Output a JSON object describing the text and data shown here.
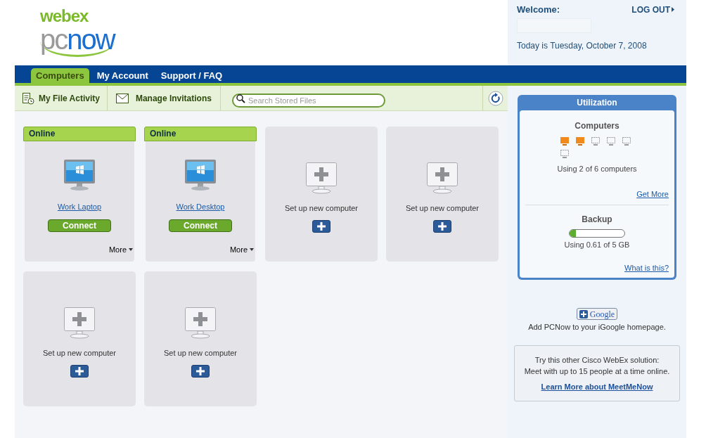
{
  "logo": {
    "brand": "webex",
    "product_prefix": "pc",
    "product_suffix": "now"
  },
  "welcome": {
    "label": "Welcome:",
    "logout": "LOG OUT",
    "date": "Today is Tuesday, October 7, 2008"
  },
  "nav_tabs": [
    {
      "label": "Computers",
      "selected": true
    },
    {
      "label": "My Account",
      "selected": false
    },
    {
      "label": "Support / FAQ",
      "selected": false
    }
  ],
  "toolbar": {
    "file_activity": "My File Activity",
    "invitations": "Manage Invitations",
    "search": {
      "placeholder": "Search Stored Files"
    }
  },
  "computers": [
    {
      "kind": "online",
      "status": "Online",
      "name": "Work Laptop",
      "action": "Connect",
      "more": "More"
    },
    {
      "kind": "online",
      "status": "Online",
      "name": "Work Desktop",
      "action": "Connect",
      "more": "More"
    },
    {
      "kind": "empty",
      "label": "Set up new computer"
    },
    {
      "kind": "empty",
      "label": "Set up new computer"
    },
    {
      "kind": "empty",
      "label": "Set up new computer"
    },
    {
      "kind": "empty",
      "label": "Set up new computer"
    }
  ],
  "utilization": {
    "title": "Utilization",
    "computers_heading": "Computers",
    "slots": [
      {
        "used": true
      },
      {
        "used": true
      },
      {
        "used": false
      },
      {
        "used": false
      },
      {
        "used": false
      },
      {
        "used": false
      }
    ],
    "computers_text": "Using 2 of 6 computers",
    "get_more": "Get More",
    "backup_heading": "Backup",
    "level": 0.12,
    "backup_text": "Using 0.61 of 5 GB",
    "what_is_this": "What is this?"
  },
  "igoogle": {
    "button": "Google",
    "text": "Add PCNow to your iGoogle homepage."
  },
  "promo": {
    "line_1": "Try this other Cisco WebEx solution:",
    "line_2": "Meet with up to 15 people at a time online.",
    "link": "Learn More about MeetMeNow"
  }
}
